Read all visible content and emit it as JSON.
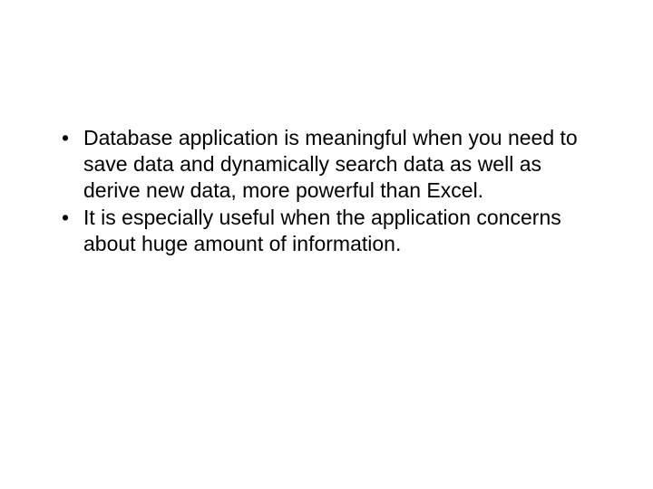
{
  "bullets": {
    "item1": "Database application is meaningful when you need to save data and dynamically search data as well as derive new data, more powerful than Excel.",
    "item2": "It is especially useful when the application concerns about huge amount of information."
  }
}
